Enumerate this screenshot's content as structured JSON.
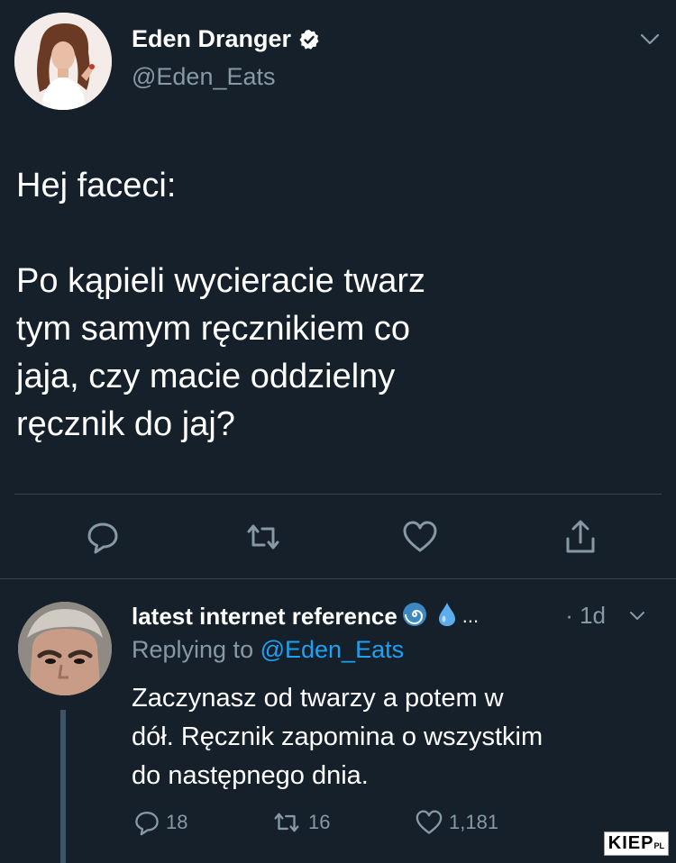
{
  "main_tweet": {
    "author_name": "Eden Dranger",
    "author_handle": "@Eden_Eats",
    "text": "Hej faceci:\n\nPo kąpieli wycieracie twarz\ntym samym ręcznikiem co\njaja, czy macie oddzielny\nręcznik do jaj?",
    "icons": [
      "verified-badge-icon",
      "chevron-down-icon",
      "reply-icon",
      "retweet-icon",
      "like-icon",
      "share-icon"
    ]
  },
  "reply_tweet": {
    "author_name": "latest internet reference",
    "name_suffix": "...",
    "time": "· 1d",
    "replying_prefix": "Replying to ",
    "replying_to": "@Eden_Eats",
    "text": "Zaczynasz od twarzy a potem w\ndół. Ręcznik zapomina o wszystkim\ndo następnego dnia.",
    "reply_count": "18",
    "retweet_count": "16",
    "like_count": "1,181",
    "icons": [
      "cyclone-emoji-icon",
      "droplet-emoji-icon",
      "chevron-down-icon",
      "reply-icon",
      "retweet-icon",
      "like-icon"
    ]
  },
  "watermark": {
    "text": "KIEP",
    "suffix": "PL"
  },
  "colors": {
    "background": "#15202b",
    "secondary_text": "#8899a6",
    "link": "#1da1f2",
    "divider": "#38444d"
  }
}
